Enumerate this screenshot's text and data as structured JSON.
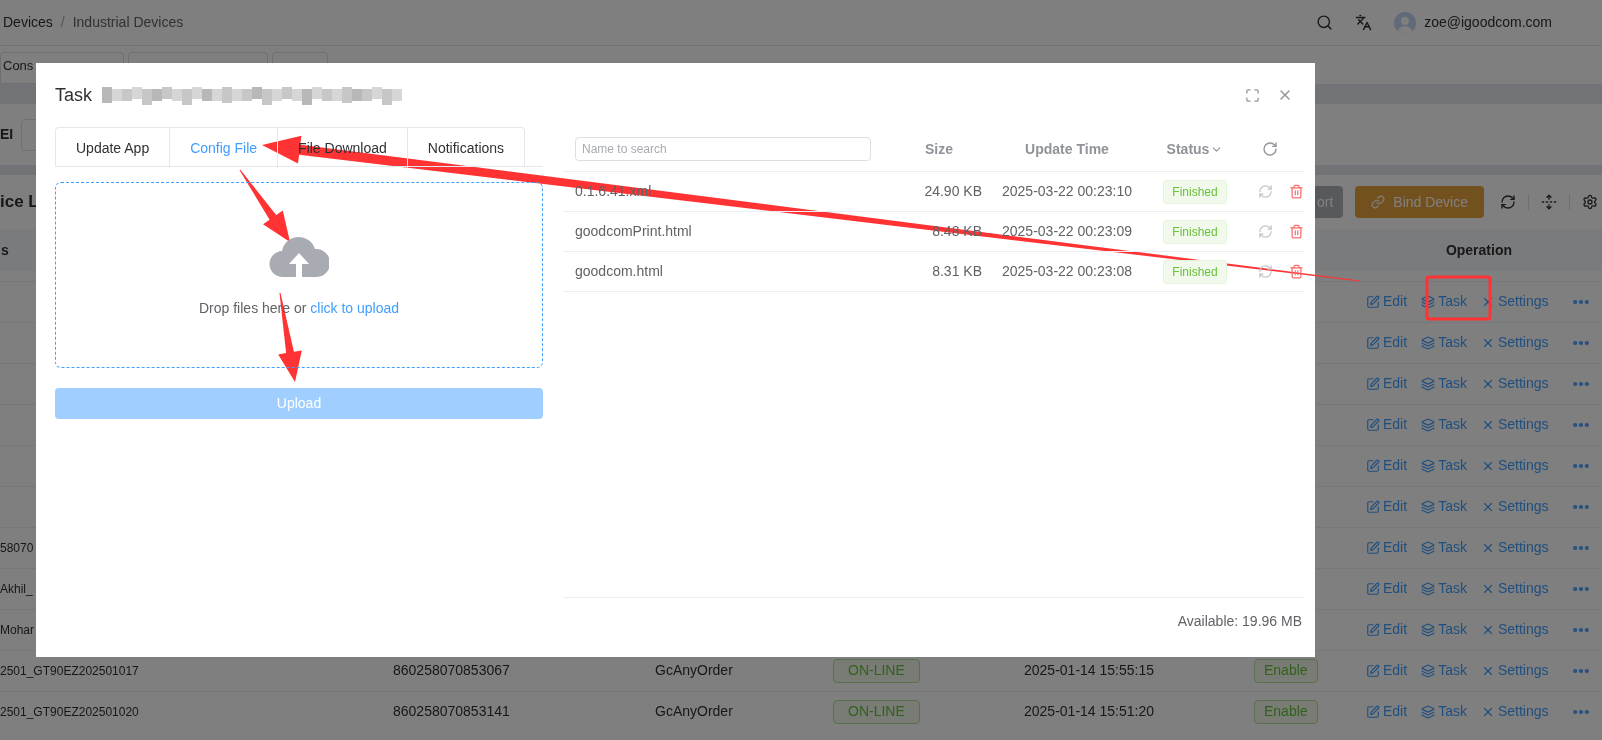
{
  "header": {
    "breadcrumb": [
      "Devices",
      "Industrial Devices"
    ],
    "separator": "/",
    "user": "zoe@igoodcom.com"
  },
  "page_tabs": [
    {
      "label": "Cons"
    }
  ],
  "filter": {
    "label": "EI"
  },
  "list": {
    "title": "ice L",
    "buttons": [
      {
        "label": "ort",
        "kind": "export"
      },
      {
        "label": "Bind Device",
        "kind": "bind"
      }
    ]
  },
  "table": {
    "columns": [
      "s",
      "Operation"
    ],
    "rows": [
      {
        "actions": [
          "Edit",
          "Task",
          "Settings"
        ]
      },
      {
        "actions": [
          "Edit",
          "Task",
          "Settings"
        ]
      },
      {
        "actions": [
          "Edit",
          "Task",
          "Settings"
        ]
      },
      {
        "actions": [
          "Edit",
          "Task",
          "Settings"
        ]
      },
      {
        "actions": [
          "Edit",
          "Task",
          "Settings"
        ]
      },
      {
        "actions": [
          "Edit",
          "Task",
          "Settings"
        ]
      },
      {
        "column_1": "58070",
        "actions": [
          "Edit",
          "Task",
          "Settings"
        ]
      },
      {
        "column_1": "Akhil_",
        "actions": [
          "Edit",
          "Task",
          "Settings"
        ]
      },
      {
        "column_1": "Mohar",
        "actions": [
          "Edit",
          "Task",
          "Settings"
        ]
      },
      {
        "column_1": "2501_GT90EZ202501017",
        "column_2": "860258070853067",
        "column_3": "GcAnyOrder",
        "column_4": "ON-LINE",
        "column_5": "2025-01-14 15:55:15",
        "column_6": "Enable",
        "actions": [
          "Edit",
          "Task",
          "Settings"
        ]
      },
      {
        "column_1": "2501_GT90EZ202501020",
        "column_2": "860258070853141",
        "column_3": "GcAnyOrder",
        "column_4": "ON-LINE",
        "column_5": "2025-01-14 15:51:20",
        "column_6": "Enable",
        "actions": [
          "Edit",
          "Task",
          "Settings"
        ]
      }
    ]
  },
  "dialog": {
    "title": "Task",
    "tabs": [
      {
        "label": "Update App",
        "selected": false
      },
      {
        "label": "Config File",
        "selected": true
      },
      {
        "label": "File Download",
        "selected": false
      },
      {
        "label": "Notifications",
        "selected": false
      }
    ],
    "upload": {
      "hint": "Drop files here or ",
      "link": "click to upload",
      "button": "Upload",
      "disabled": true
    },
    "files": {
      "search_placeholder": "Name to search",
      "columns": [
        "Size",
        "Update Time",
        "Status"
      ],
      "rows": [
        {
          "name": "0.1.6.41.xml",
          "size": "24.90 KB",
          "time": "2025-03-22 00:23:10",
          "status": "Finished"
        },
        {
          "name": "goodcomPrint.html",
          "size": "8.48 KB",
          "time": "2025-03-22 00:23:09",
          "status": "Finished"
        },
        {
          "name": "goodcom.html",
          "size": "8.31 KB",
          "time": "2025-03-22 00:23:08",
          "status": "Finished"
        }
      ],
      "available": "Available: 19.96 MB"
    }
  }
}
